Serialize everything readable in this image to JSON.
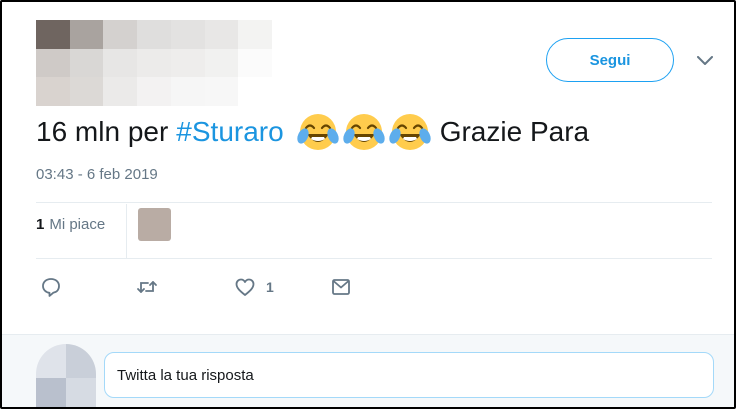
{
  "header": {
    "follow_label": "Segui",
    "caret_icon": "chevron-down-icon",
    "blurred_profile_colors": [
      "#6f6560",
      "#a9a39f",
      "#d4d1cf",
      "#dfdedd",
      "#e3e2e1",
      "#e8e7e6",
      "#f3f3f2",
      "#cfcac7",
      "#d9d7d5",
      "#e7e6e5",
      "#ecebea",
      "#eeedec",
      "#f1f1f0",
      "#fbfbfb",
      "#d9d3cf",
      "#dcd9d6",
      "#ebeae9",
      "#f3f2f2",
      "#f6f6f6",
      "#f7f7f7",
      "#ffffff"
    ]
  },
  "tweet": {
    "text_before": "16 mln per",
    "hashtag": "#Sturaro",
    "emoji": [
      "face-with-tears-of-joy",
      "face-with-tears-of-joy",
      "face-with-tears-of-joy"
    ],
    "text_after": "Grazie Para",
    "timestamp": "03:43 - 6 feb 2019"
  },
  "stats": {
    "likes_count": "1",
    "likes_label": "Mi piace"
  },
  "actions": {
    "reply_icon": "reply-icon",
    "retweet_icon": "retweet-icon",
    "like_icon": "heart-icon",
    "like_count": "1",
    "message_icon": "envelope-icon"
  },
  "reply": {
    "placeholder": "Twitta la tua risposta",
    "avatar_colors": [
      "#dfe3ea",
      "#c9cfd9",
      "#b9c0cd",
      "#d6dbe3"
    ]
  },
  "colors": {
    "accent": "#1da1f2",
    "link": "#1b95e0",
    "muted": "#657786",
    "reply_bar": "#f5f8fa"
  }
}
